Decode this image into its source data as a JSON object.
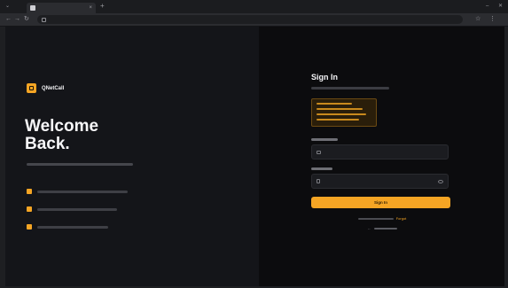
{
  "browser": {
    "tab_title": "",
    "url": "",
    "new_tab": "+",
    "tab_close": "×"
  },
  "brand": {
    "name": "QNetCall"
  },
  "hero": {
    "title": "Welcome\nBack.",
    "features": [
      {
        "icon": "feature-icon"
      },
      {
        "icon": "feature-icon"
      },
      {
        "icon": "feature-icon"
      }
    ]
  },
  "signin": {
    "title": "Sign In",
    "email_placeholder": "",
    "password_placeholder": "",
    "button_label": "Sign In",
    "forgot_link": "Forgot"
  },
  "colors": {
    "accent": "#f5a524",
    "left_bg": "#141519",
    "right_bg": "#0c0c0e"
  }
}
